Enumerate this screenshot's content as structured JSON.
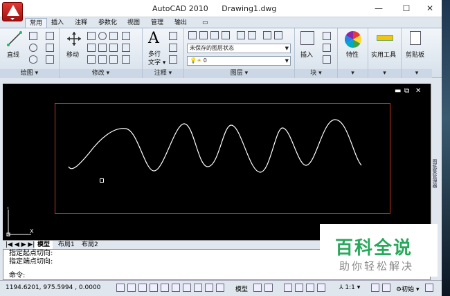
{
  "window": {
    "app_name": "AutoCAD 2010",
    "document": "Drawing1.dwg",
    "controls": {
      "minimize": "—",
      "maximize": "☐",
      "close": "✕"
    }
  },
  "tabs": [
    "常用",
    "插入",
    "注释",
    "参数化",
    "视图",
    "管理",
    "输出"
  ],
  "active_tab": "常用",
  "ribbon": {
    "draw": {
      "title": "绘图 ▾",
      "line_label": "直线"
    },
    "modify": {
      "title": "修改 ▾",
      "move_label": "移动"
    },
    "annotation": {
      "title": "注释 ▾",
      "text_label": "多行\n文字",
      "text_label_line1": "多行",
      "text_label_line2": "文字 ▾"
    },
    "layers": {
      "title": "图层 ▾",
      "layer_state": "未保存的图层状态",
      "current_layer": "0"
    },
    "block": {
      "title": "块 ▾",
      "insert_label": "插入"
    },
    "properties": {
      "label": "特性"
    },
    "utilities": {
      "label": "实用工具"
    },
    "clipboard": {
      "label": "剪贴板"
    }
  },
  "viewport_controls": {
    "minimize": "▬",
    "restore": "⧉",
    "close": "✕"
  },
  "ucs": {
    "x": "X",
    "y": "Y"
  },
  "layout_tabs": [
    "模型",
    "布局1",
    "布局2"
  ],
  "active_layout": "模型",
  "command_history": [
    "指定起点切向:",
    "指定端点切向:"
  ],
  "command_prompt": "命令:",
  "status": {
    "coords": "1194.6201, 975.5994 , 0.0000",
    "model": "模型",
    "scale": "1:1 ▾",
    "workspace": "初始 ▾"
  },
  "side_panel_label": "图纸集管理器",
  "watermark": {
    "title": "百科全说",
    "subtitle": "助你轻松解决"
  },
  "colors": {
    "frame": "#c0392b",
    "curve": "#ffffff",
    "canvas": "#000000",
    "watermark_green": "#27a85a"
  }
}
